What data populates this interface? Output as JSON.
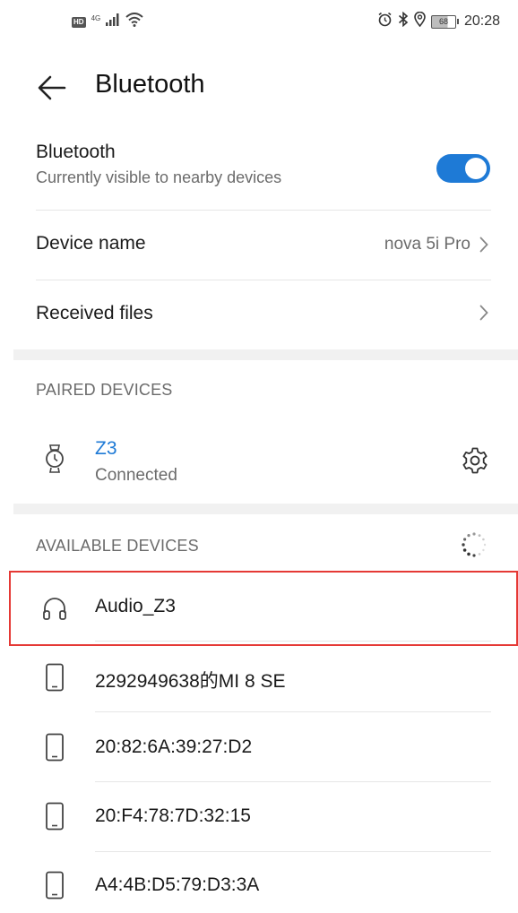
{
  "status_bar": {
    "hd_badge": "HD",
    "network_type": "4G",
    "time": "20:28",
    "battery_level": "68"
  },
  "header": {
    "title": "Bluetooth"
  },
  "bluetooth_toggle": {
    "title": "Bluetooth",
    "subtitle": "Currently visible to nearby devices",
    "enabled": true,
    "accent_color": "#1e7ad6"
  },
  "device_name": {
    "label": "Device name",
    "value": "nova 5i Pro"
  },
  "received_files": {
    "label": "Received files"
  },
  "paired_devices": {
    "header": "PAIRED DEVICES",
    "items": [
      {
        "name": "Z3",
        "status": "Connected",
        "icon": "watch-icon"
      }
    ]
  },
  "available_devices": {
    "header": "AVAILABLE DEVICES",
    "items": [
      {
        "name": "Audio_Z3",
        "icon": "headphones-icon"
      },
      {
        "name": "2292949638的MI 8 SE",
        "icon": "phone-icon"
      },
      {
        "name": "20:82:6A:39:27:D2",
        "icon": "phone-icon"
      },
      {
        "name": "20:F4:78:7D:32:15",
        "icon": "phone-icon"
      },
      {
        "name": "A4:4B:D5:79:D3:3A",
        "icon": "phone-icon"
      }
    ]
  }
}
